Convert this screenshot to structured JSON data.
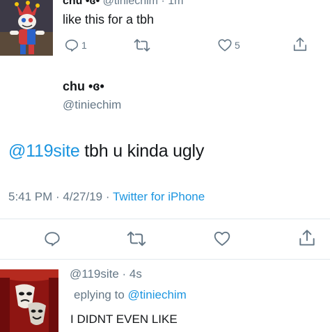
{
  "top_tweet": {
    "name": "chu •ɞ•",
    "handle_time": "@tiniechim · 1m",
    "text": "like this for a tbh",
    "reply_count": "1",
    "like_count": "5"
  },
  "main_tweet": {
    "name": "chu •ɞ•",
    "handle": "@tiniechim",
    "mention": "@119site",
    "text_rest": " tbh u kinda ugly",
    "time_date": "5:41 PM · 4/27/19 · ",
    "source": "Twitter for iPhone"
  },
  "reply_tweet": {
    "handle_time": "@119site · 4s",
    "replying_prefix": "eplying to ",
    "replying_to": "@tiniechim",
    "text": "I DIDNT EVEN LIKE"
  },
  "colors": {
    "link": "#1b95e0",
    "secondary_text": "#657786",
    "divider": "#e1e8ed"
  }
}
